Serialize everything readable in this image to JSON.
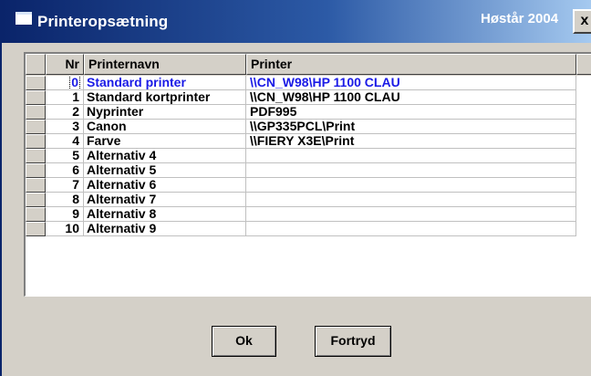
{
  "window": {
    "title": "Printeropsætning",
    "right_label": "Høstår 2004",
    "close_glyph": "x"
  },
  "grid": {
    "columns": [
      "Nr",
      "Printernavn",
      "Printer"
    ],
    "rows": [
      {
        "nr": "0",
        "name": "Standard printer",
        "printer": "\\\\CN_W98\\HP 1100 CLAU",
        "active": true
      },
      {
        "nr": "1",
        "name": "Standard kortprinter",
        "printer": "\\\\CN_W98\\HP 1100 CLAU"
      },
      {
        "nr": "2",
        "name": "Nyprinter",
        "printer": "PDF995"
      },
      {
        "nr": "3",
        "name": "Canon",
        "printer": "\\\\GP335PCL\\Print"
      },
      {
        "nr": "4",
        "name": "Farve",
        "printer": "\\\\FIERY X3E\\Print"
      },
      {
        "nr": "5",
        "name": "Alternativ 4",
        "printer": ""
      },
      {
        "nr": "6",
        "name": "Alternativ 5",
        "printer": ""
      },
      {
        "nr": "7",
        "name": "Alternativ 6",
        "printer": ""
      },
      {
        "nr": "8",
        "name": "Alternativ 7",
        "printer": ""
      },
      {
        "nr": "9",
        "name": "Alternativ 8",
        "printer": ""
      },
      {
        "nr": "10",
        "name": "Alternativ 9",
        "printer": ""
      }
    ],
    "active_color": "#1a1ae6"
  },
  "buttons": {
    "ok_label": "Ok",
    "cancel_label": "Fortryd"
  }
}
